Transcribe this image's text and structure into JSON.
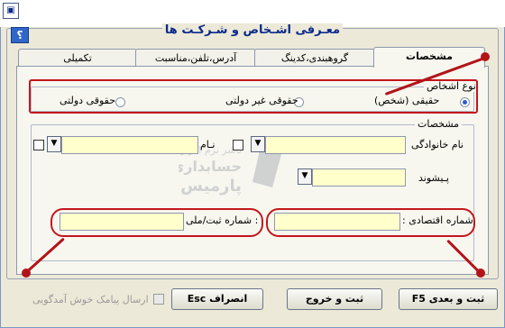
{
  "window": {
    "title": "معـرفی اشـخاص و شـرکـت ها",
    "help_label": "؟"
  },
  "tabs": [
    {
      "label": "مشخصات"
    },
    {
      "label": "گروهبندی،کدینگ"
    },
    {
      "label": "آدرس،تلفن،مناسبت"
    },
    {
      "label": "تکمیلی"
    }
  ],
  "person_type": {
    "legend": "نوع اشخاص",
    "options": [
      {
        "label": "حقیقی (شخص)",
        "selected": true
      },
      {
        "label": "حقوقی غیر دولتی",
        "selected": false
      },
      {
        "label": "حقوقی دولتی",
        "selected": false
      }
    ]
  },
  "details": {
    "legend": "مشخصات",
    "last_name_label": "نام خانوادگی",
    "first_name_label": "نـام",
    "prefix_label": "پـیشوند",
    "economic_code_label": "شماره اقتصادی :",
    "national_id_label": ": شماره ثبت/ملی"
  },
  "footer": {
    "next_label": "ثبت و بعدی F5",
    "save_exit_label": "ثبت و خروج",
    "cancel_label": "انصراف Esc",
    "sms_label": "ارسال پیامک خوش آمدگویی"
  },
  "watermark": {
    "line1": "ناشر نرم افزار",
    "line2": "حسابداری",
    "line3": "پارمیس"
  },
  "colors": {
    "accent_red": "#c4161c",
    "title_blue": "#0a2a8c",
    "input_yellow": "#ffffcc"
  }
}
